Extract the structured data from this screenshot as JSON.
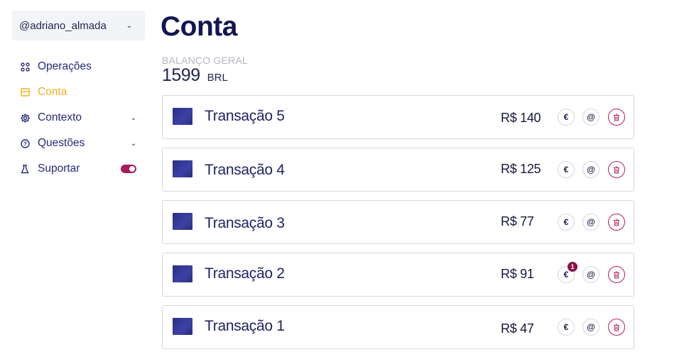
{
  "user": {
    "handle": "@adriano_almada"
  },
  "nav": {
    "items": [
      {
        "label": "Operações",
        "icon": "grid-icon"
      },
      {
        "label": "Conta",
        "icon": "wallet-icon",
        "active": true
      },
      {
        "label": "Contexto",
        "icon": "settings-icon"
      },
      {
        "label": "Questões",
        "icon": "help-icon"
      },
      {
        "label": "Suportar",
        "icon": "flask-icon",
        "toggle_on": true
      }
    ]
  },
  "header": {
    "title": "Conta",
    "balance_label": "BALANÇO GERAL",
    "balance_value": "1599",
    "balance_currency": "BRL"
  },
  "transactions": [
    {
      "title": "Transação 5",
      "amount": "R$ 140"
    },
    {
      "title": "Transação 4",
      "amount": "R$ 125"
    },
    {
      "title": "Transação 3",
      "amount": "R$ 77"
    },
    {
      "title": "Transação 2",
      "amount": "R$ 91",
      "badge": "1"
    },
    {
      "title": "Transação 1",
      "amount": "R$ 47"
    }
  ],
  "colors": {
    "accent_active": "#f2b01e",
    "nav_text": "#262a7a",
    "danger": "#b01f56",
    "badge": "#8e1248"
  }
}
